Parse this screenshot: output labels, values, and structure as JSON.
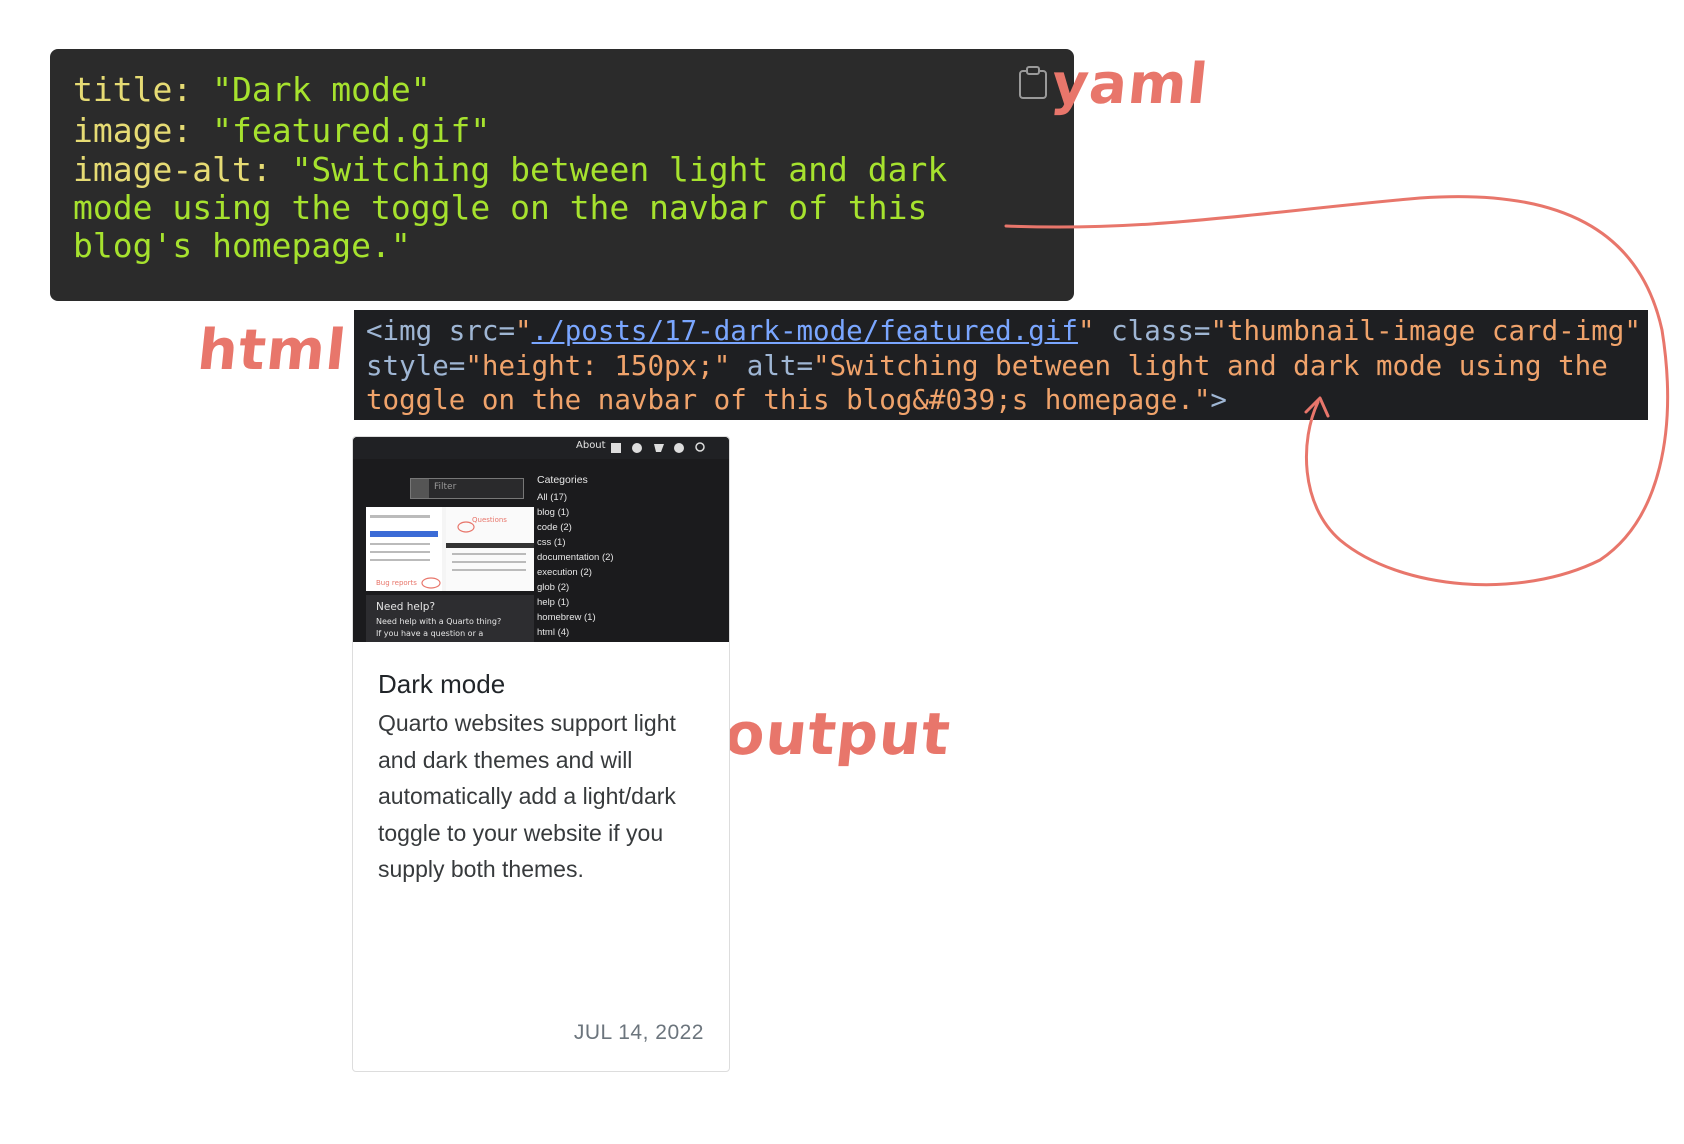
{
  "yaml": {
    "lines": [
      {
        "key": "title",
        "sep": ": ",
        "value": "\"Dark mode\""
      },
      {
        "key": "image",
        "sep": ": ",
        "value": "\"featured.gif\""
      },
      {
        "key": "image-alt",
        "sep": ": ",
        "value": "\"Switching between light and dark mode using the toggle on the navbar of this blog's homepage.\""
      }
    ],
    "copy_icon": "clipboard-icon"
  },
  "html_code": {
    "open": "<img",
    "src_attr": " src=",
    "q1": "\"",
    "src_value": "./posts/17-dark-mode/featured.gif",
    "q2": "\"",
    "class_attr": " class=",
    "class_value": "\"thumbnail-image card-img\"",
    "style_attr": " style=",
    "style_value": "\"height: 150px;\"",
    "alt_attr": " alt=",
    "alt_value": "\"Switching between light and dark mode using the toggle on the navbar of this blog&#039;s homepage.\"",
    "close": ">"
  },
  "annotations": {
    "yaml": "yaml",
    "html": "html",
    "output": "output",
    "color": "#e8766b"
  },
  "card": {
    "thumbnail": {
      "nav_about": "About",
      "filter_placeholder": "Filter",
      "categories_title": "Categories",
      "categories": [
        "All (17)",
        "blog (1)",
        "code (2)",
        "css (1)",
        "documentation (2)",
        "execution (2)",
        "glob (2)",
        "help (1)",
        "homebrew (1)",
        "html (4)"
      ],
      "shot_label_top": "Questions",
      "shot_label_bottom": "Bug reports",
      "help_title": "Need help?",
      "help_text": "Need help with a Quarto thing? If you have a question or a feature"
    },
    "title": "Dark mode",
    "description": "Quarto websites support light and dark themes and will automatically add a light/dark toggle to your website if you supply both themes.",
    "date": "JUL 14, 2022"
  }
}
